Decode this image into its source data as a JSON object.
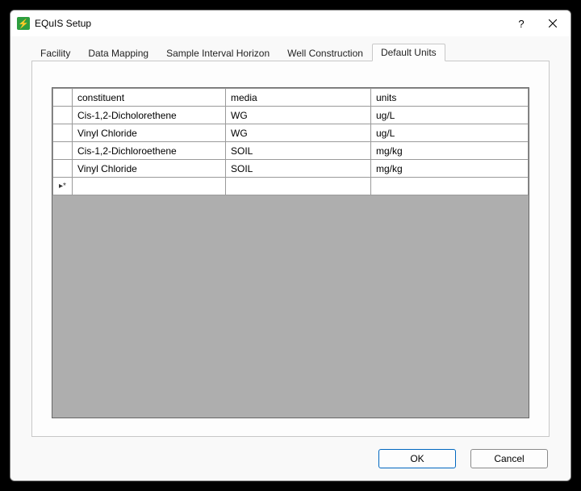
{
  "window": {
    "title": "EQuIS Setup",
    "help_glyph": "?",
    "icon_glyph": "⚡"
  },
  "tabs": [
    {
      "label": "Facility",
      "active": false
    },
    {
      "label": "Data Mapping",
      "active": false
    },
    {
      "label": "Sample Interval Horizon",
      "active": false
    },
    {
      "label": "Well Construction",
      "active": false
    },
    {
      "label": "Default Units",
      "active": true
    }
  ],
  "grid": {
    "columns": [
      "constituent",
      "media",
      "units"
    ],
    "rows": [
      {
        "constituent": "Cis-1,2-Dicholorethene",
        "media": "WG",
        "units": "ug/L"
      },
      {
        "constituent": "Vinyl Chloride",
        "media": "WG",
        "units": "ug/L"
      },
      {
        "constituent": "Cis-1,2-Dichloroethene",
        "media": "SOIL",
        "units": "mg/kg"
      },
      {
        "constituent": "Vinyl Chloride",
        "media": "SOIL",
        "units": "mg/kg"
      }
    ],
    "new_row_marker": "▸*"
  },
  "buttons": {
    "ok": "OK",
    "cancel": "Cancel"
  }
}
